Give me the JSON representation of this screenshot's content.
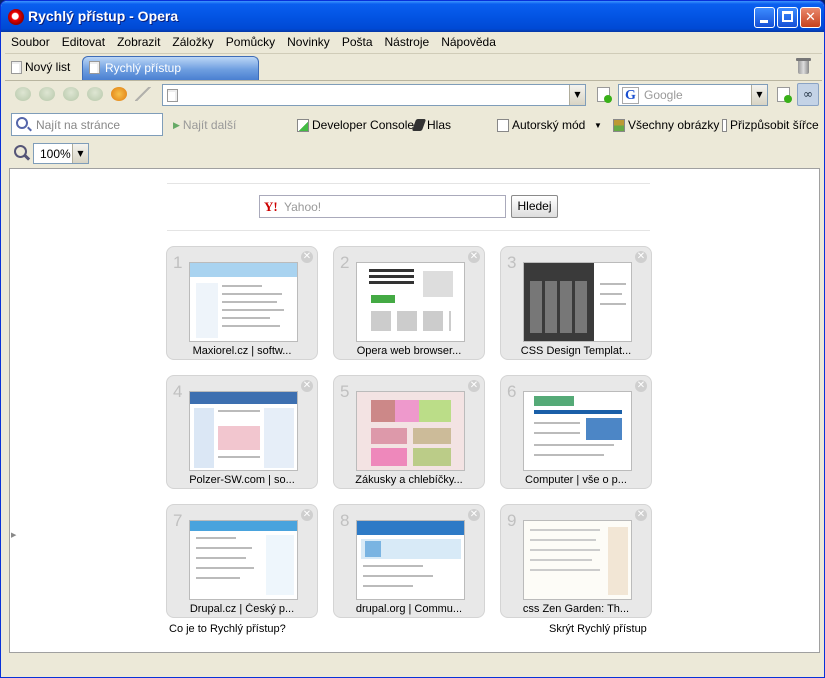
{
  "window": {
    "title": "Rychlý přístup - Opera"
  },
  "menu": [
    "Soubor",
    "Editovat",
    "Zobrazit",
    "Záložky",
    "Pomůcky",
    "Novinky",
    "Pošta",
    "Nástroje",
    "Nápověda"
  ],
  "tabs": {
    "new_tab": "Nový list",
    "active": "Rychlý přístup"
  },
  "address": {
    "value": ""
  },
  "search": {
    "engine": "Google",
    "placeholder": "Google"
  },
  "findbar": {
    "find_placeholder": "Najít na stránce",
    "find_next": "Najít další",
    "developer_console": "Developer Console",
    "voice": "Hlas",
    "author_mode": "Autorský mód",
    "all_images": "Všechny obrázky",
    "fit_width": "Přizpůsobit šířce"
  },
  "zoom": {
    "value": "100%"
  },
  "speed_dial": {
    "search_placeholder": "Yahoo!",
    "search_button": "Hledej",
    "dials": [
      {
        "num": "1",
        "title": "Maxiorel.cz | softw..."
      },
      {
        "num": "2",
        "title": "Opera web browser..."
      },
      {
        "num": "3",
        "title": "CSS Design Templat..."
      },
      {
        "num": "4",
        "title": "Polzer-SW.com | so..."
      },
      {
        "num": "5",
        "title": "Zákusky a chlebíčky..."
      },
      {
        "num": "6",
        "title": "Computer | vše o p..."
      },
      {
        "num": "7",
        "title": "Drupal.cz | Český p..."
      },
      {
        "num": "8",
        "title": "drupal.org | Commu..."
      },
      {
        "num": "9",
        "title": "css Zen Garden: Th..."
      }
    ],
    "what_is": "Co je to Rychlý přístup?",
    "hide": "Skrýt Rychlý přístup"
  }
}
